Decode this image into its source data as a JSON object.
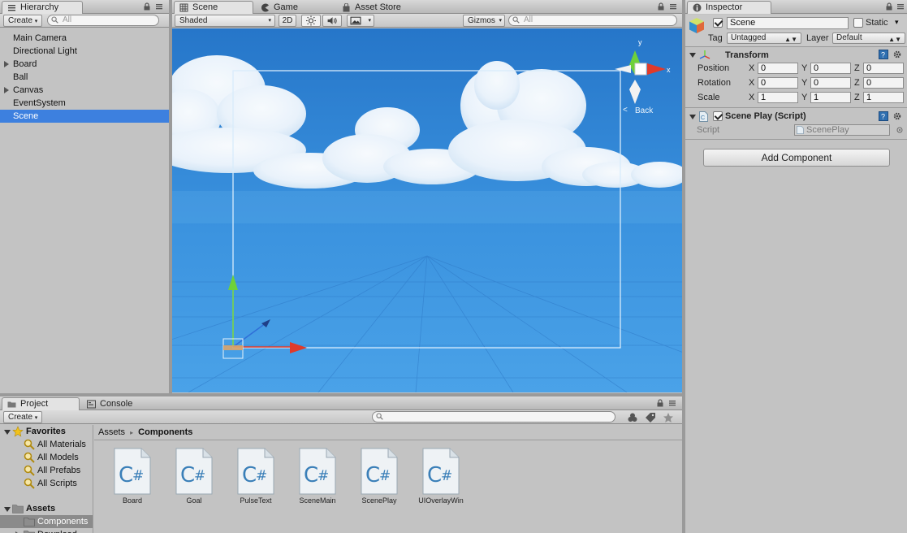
{
  "hierarchy": {
    "tab_label": "Hierarchy",
    "create_label": "Create",
    "search_placeholder": "All",
    "items": [
      {
        "label": "Main Camera",
        "foldable": false,
        "selected": false
      },
      {
        "label": "Directional Light",
        "foldable": false,
        "selected": false
      },
      {
        "label": "Board",
        "foldable": true,
        "selected": false
      },
      {
        "label": "Ball",
        "foldable": false,
        "selected": false
      },
      {
        "label": "Canvas",
        "foldable": true,
        "selected": false
      },
      {
        "label": "EventSystem",
        "foldable": false,
        "selected": false
      },
      {
        "label": "Scene",
        "foldable": false,
        "selected": true
      }
    ]
  },
  "scene": {
    "tabs": [
      {
        "label": "Scene",
        "icon": "grid-icon",
        "active": true
      },
      {
        "label": "Game",
        "icon": "pacman-icon",
        "active": false
      },
      {
        "label": "Asset Store",
        "icon": "bag-icon",
        "active": false
      }
    ],
    "toolbar": {
      "shading": "Shaded",
      "mode_2d": "2D",
      "gizmos": "Gizmos",
      "search_placeholder": "All"
    },
    "gizmo": {
      "axis_x": "x",
      "axis_y": "y",
      "view_label": "Back"
    }
  },
  "inspector": {
    "tab_label": "Inspector",
    "object_name": "Scene",
    "object_active": true,
    "static_label": "Static",
    "tag_label": "Tag",
    "tag_value": "Untagged",
    "layer_label": "Layer",
    "layer_value": "Default",
    "transform": {
      "title": "Transform",
      "rows": [
        {
          "label": "Position",
          "x": "0",
          "y": "0",
          "z": "0"
        },
        {
          "label": "Rotation",
          "x": "0",
          "y": "0",
          "z": "0"
        },
        {
          "label": "Scale",
          "x": "1",
          "y": "1",
          "z": "1"
        }
      ],
      "axis_labels": [
        "X",
        "Y",
        "Z"
      ]
    },
    "script_component": {
      "title": "Scene Play (Script)",
      "enabled": true,
      "field_label": "Script",
      "field_value": "ScenePlay"
    },
    "add_component_label": "Add Component"
  },
  "project": {
    "tabs": [
      {
        "label": "Project",
        "icon": "folder-icon",
        "active": true
      },
      {
        "label": "Console",
        "icon": "console-icon",
        "active": false
      }
    ],
    "create_label": "Create",
    "favorites_label": "Favorites",
    "favorites": [
      "All Materials",
      "All Models",
      "All Prefabs",
      "All Scripts"
    ],
    "assets_label": "Assets",
    "asset_folders": [
      {
        "label": "Components",
        "selected": true
      },
      {
        "label": "Download",
        "selected": false
      }
    ],
    "breadcrumb": [
      "Assets",
      "Components"
    ],
    "files": [
      {
        "name": "Board",
        "icon": "csharp-script-icon"
      },
      {
        "name": "Goal",
        "icon": "csharp-script-icon"
      },
      {
        "name": "PulseText",
        "icon": "csharp-script-icon"
      },
      {
        "name": "SceneMain",
        "icon": "csharp-script-icon"
      },
      {
        "name": "ScenePlay",
        "icon": "csharp-script-icon"
      },
      {
        "name": "UIOverlayWin",
        "icon": "csharp-script-icon"
      }
    ]
  },
  "colors": {
    "selection": "#3d80df",
    "sky_top": "#2a7fd0",
    "sky_bottom": "#4aa3e8",
    "axis_x": "#e03a2a",
    "axis_y": "#6fd13a",
    "axis_z": "#2f6fd8"
  }
}
